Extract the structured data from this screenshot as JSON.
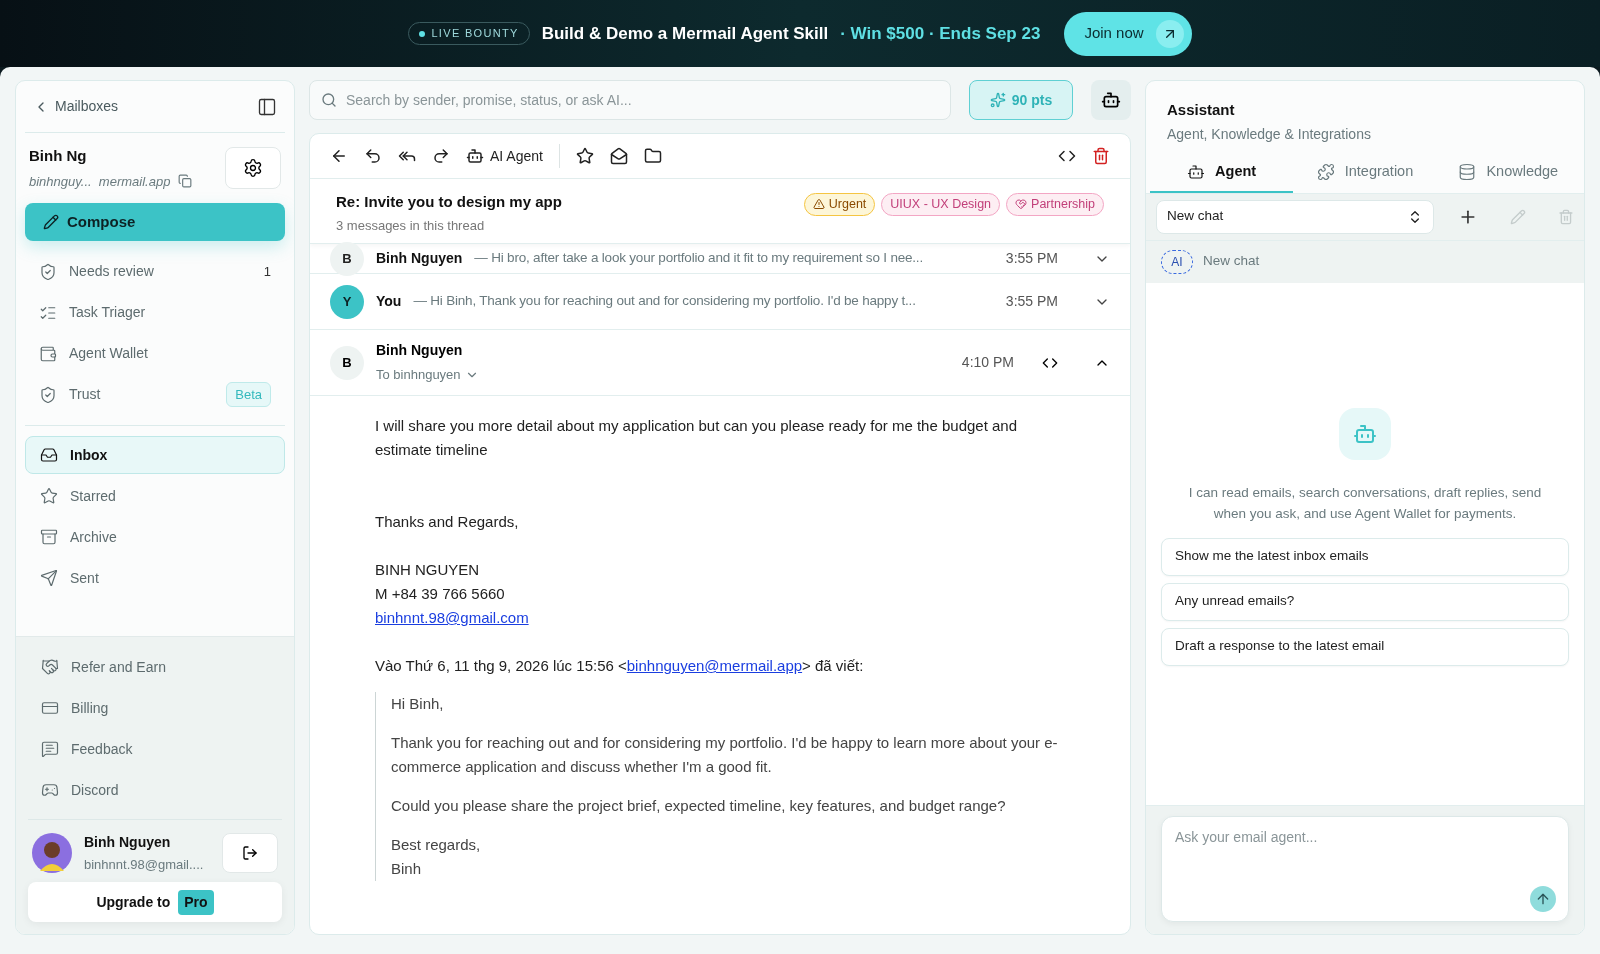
{
  "banner": {
    "badge": "LIVE BOUNTY",
    "title": "Build & Demo a Mermail Agent Skill",
    "highlight": "· Win $500 · Ends Sep 23",
    "button": "Join now"
  },
  "sidebar": {
    "back": "Mailboxes",
    "account_name": "Binh Ng",
    "account_email": "binhnguy...  mermail.app",
    "compose": "Compose",
    "tools": [
      {
        "kind": "shield",
        "label": "Needs review",
        "count": "1"
      },
      {
        "kind": "tasks",
        "label": "Task Triager"
      },
      {
        "kind": "wallet",
        "label": "Agent Wallet"
      },
      {
        "kind": "shield",
        "label": "Trust",
        "badge": "Beta"
      }
    ],
    "folders": [
      {
        "kind": "inbox",
        "label": "Inbox",
        "selected": true
      },
      {
        "kind": "star",
        "label": "Starred",
        "selected": false
      },
      {
        "kind": "archive",
        "label": "Archive",
        "selected": false
      },
      {
        "kind": "send",
        "label": "Sent",
        "selected": false
      }
    ],
    "extras": [
      {
        "kind": "handshake",
        "label": "Refer and Earn"
      },
      {
        "kind": "card",
        "label": "Billing"
      },
      {
        "kind": "chat",
        "label": "Feedback"
      },
      {
        "kind": "discord",
        "label": "Discord"
      }
    ],
    "user": {
      "name": "Binh Nguyen",
      "email": "binhnnt.98@gmail...."
    },
    "upgrade": {
      "label": "Upgrade to",
      "badge": "Pro"
    }
  },
  "search": {
    "placeholder": "Search by sender, promise, status, or ask AI..."
  },
  "points": "90 pts",
  "toolbar": {
    "ai_agent": "AI Agent"
  },
  "thread": {
    "subject": "Re: Invite you to design my app",
    "count": "3 messages in this thread",
    "tags": [
      {
        "kind": "urgent",
        "label": "Urgent",
        "color": "#f5c542"
      },
      {
        "kind": "plain",
        "label": "UIUX - UX Design",
        "color": "#f3a6c4"
      },
      {
        "kind": "partner",
        "label": "Partnership",
        "color": "#f3a6c4"
      }
    ],
    "collapsed": [
      {
        "initial": "B",
        "sender": "Binh Nguyen",
        "preview": "— Hi bro, after take a look your portfolio and it fit to my requirement so I nee...",
        "time": "3:55 PM",
        "mine": false
      },
      {
        "initial": "Y",
        "sender": "You",
        "preview": "— Hi Binh, Thank you for reaching out and for considering my portfolio. I'd be happy t...",
        "time": "3:55 PM",
        "mine": true
      }
    ],
    "open": {
      "initial": "B",
      "sender": "Binh Nguyen",
      "to": "To binhnguyen",
      "time": "4:10 PM",
      "body": [
        "I will share you more detail about my application but can you please ready for me the budget and estimate timeline",
        "Thanks and Regards,"
      ],
      "signature": [
        "BINH NGUYEN",
        "M +84 39 766 5660"
      ],
      "signature_link": "binhnnt.98@gmail.com",
      "quote_intro": {
        "before": "Vào Thứ 6, 11 thg 9, 2026 lúc 15:56 <",
        "link": "binhnguyen@mermail.app",
        "after": "> đã viết:"
      },
      "quote": [
        "Hi Binh,",
        "Thank you for reaching out and for considering my portfolio. I'd be happy to learn more about your e-commerce application and discuss whether I'm a good fit.",
        "Could you please share the project brief, expected timeline, key features, and budget range?",
        "Best regards,\nBinh"
      ]
    }
  },
  "assistant": {
    "title": "Assistant",
    "subtitle": "Agent, Knowledge & Integrations",
    "tabs": [
      {
        "kind": "bot",
        "label": "Agent",
        "selected": true
      },
      {
        "kind": "puzzle",
        "label": "Integration",
        "selected": false
      },
      {
        "kind": "db",
        "label": "Knowledge",
        "selected": false
      }
    ],
    "chat_select": "New chat",
    "chat_badge": "AI",
    "chat_item": "New chat",
    "intro": "I can read emails, search conversations, draft replies, send when you ask, and use Agent Wallet for payments.",
    "suggestions": [
      "Show me the latest inbox emails",
      "Any unread emails?",
      "Draft a response to the latest email"
    ],
    "input_placeholder": "Ask your email agent..."
  }
}
